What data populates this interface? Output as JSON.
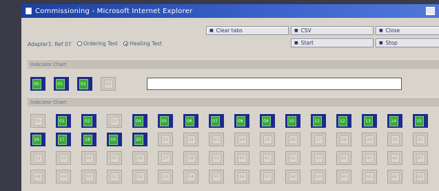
{
  "window": {
    "title": "Commissioning - Microsoft Internet Explorer"
  },
  "toolbar": {
    "adapter_label": "Adapter1: Ref 07",
    "mode_options": [
      {
        "label": "Ordering Test",
        "selected": false
      },
      {
        "label": "Heating Test",
        "selected": true
      }
    ],
    "buttons": [
      "Clear tabs",
      "CSV",
      "Close",
      "Start",
      "Stop"
    ]
  },
  "sections": {
    "top": "Indicator Chart",
    "bottom": "Indicator Chart"
  },
  "top_cells": [
    {
      "label": "00",
      "active": true
    },
    {
      "label": "01",
      "active": true
    },
    {
      "label": "02",
      "active": true
    },
    {
      "label": "03",
      "active": false
    }
  ],
  "text_field": {
    "value": ""
  },
  "bottom_cells": {
    "row1": [
      {
        "label": "00",
        "active": false
      },
      {
        "label": "01",
        "active": true
      },
      {
        "label": "02",
        "active": true
      },
      {
        "label": "03",
        "active": false
      },
      {
        "label": "04",
        "active": true
      },
      {
        "label": "05",
        "active": true
      },
      {
        "label": "06",
        "active": true
      },
      {
        "label": "07",
        "active": true
      },
      {
        "label": "08",
        "active": true
      },
      {
        "label": "09",
        "active": true
      },
      {
        "label": "10",
        "active": true
      },
      {
        "label": "11",
        "active": true
      },
      {
        "label": "12",
        "active": true
      },
      {
        "label": "13",
        "active": true
      },
      {
        "label": "14",
        "active": true
      },
      {
        "label": "15",
        "active": true
      }
    ],
    "row2": [
      {
        "label": "16",
        "active": true
      },
      {
        "label": "17",
        "active": true
      },
      {
        "label": "18",
        "active": true
      },
      {
        "label": "19",
        "active": true
      },
      {
        "label": "20",
        "active": true
      },
      {
        "label": "21",
        "active": false
      },
      {
        "label": "22",
        "active": false
      },
      {
        "label": "23",
        "active": false
      },
      {
        "label": "24",
        "active": false
      },
      {
        "label": "25",
        "active": false
      },
      {
        "label": "26",
        "active": false
      },
      {
        "label": "27",
        "active": false
      },
      {
        "label": "28",
        "active": false
      },
      {
        "label": "29",
        "active": false
      },
      {
        "label": "30",
        "active": false
      },
      {
        "label": "31",
        "active": false
      }
    ],
    "row3": [
      {
        "label": "32",
        "active": false
      },
      {
        "label": "33",
        "active": false
      },
      {
        "label": "34",
        "active": false
      },
      {
        "label": "35",
        "active": false
      },
      {
        "label": "36",
        "active": false
      },
      {
        "label": "37",
        "active": false
      },
      {
        "label": "38",
        "active": false
      },
      {
        "label": "39",
        "active": false
      },
      {
        "label": "40",
        "active": false
      },
      {
        "label": "41",
        "active": false
      },
      {
        "label": "42",
        "active": false
      },
      {
        "label": "43",
        "active": false
      },
      {
        "label": "44",
        "active": false
      },
      {
        "label": "45",
        "active": false
      },
      {
        "label": "46",
        "active": false
      },
      {
        "label": "47",
        "active": false
      }
    ],
    "row4": [
      {
        "label": "48",
        "active": false
      },
      {
        "label": "49",
        "active": false
      },
      {
        "label": "50",
        "active": false
      },
      {
        "label": "51",
        "active": false
      },
      {
        "label": "52",
        "active": false
      },
      {
        "label": "53",
        "active": false
      },
      {
        "label": "54",
        "active": false
      },
      {
        "label": "55",
        "active": false
      },
      {
        "label": "56",
        "active": false
      },
      {
        "label": "57",
        "active": false
      },
      {
        "label": "58",
        "active": false
      },
      {
        "label": "59",
        "active": false
      },
      {
        "label": "60",
        "active": false
      },
      {
        "label": "61",
        "active": false
      },
      {
        "label": "62",
        "active": false
      },
      {
        "label": "63",
        "active": false
      }
    ]
  }
}
